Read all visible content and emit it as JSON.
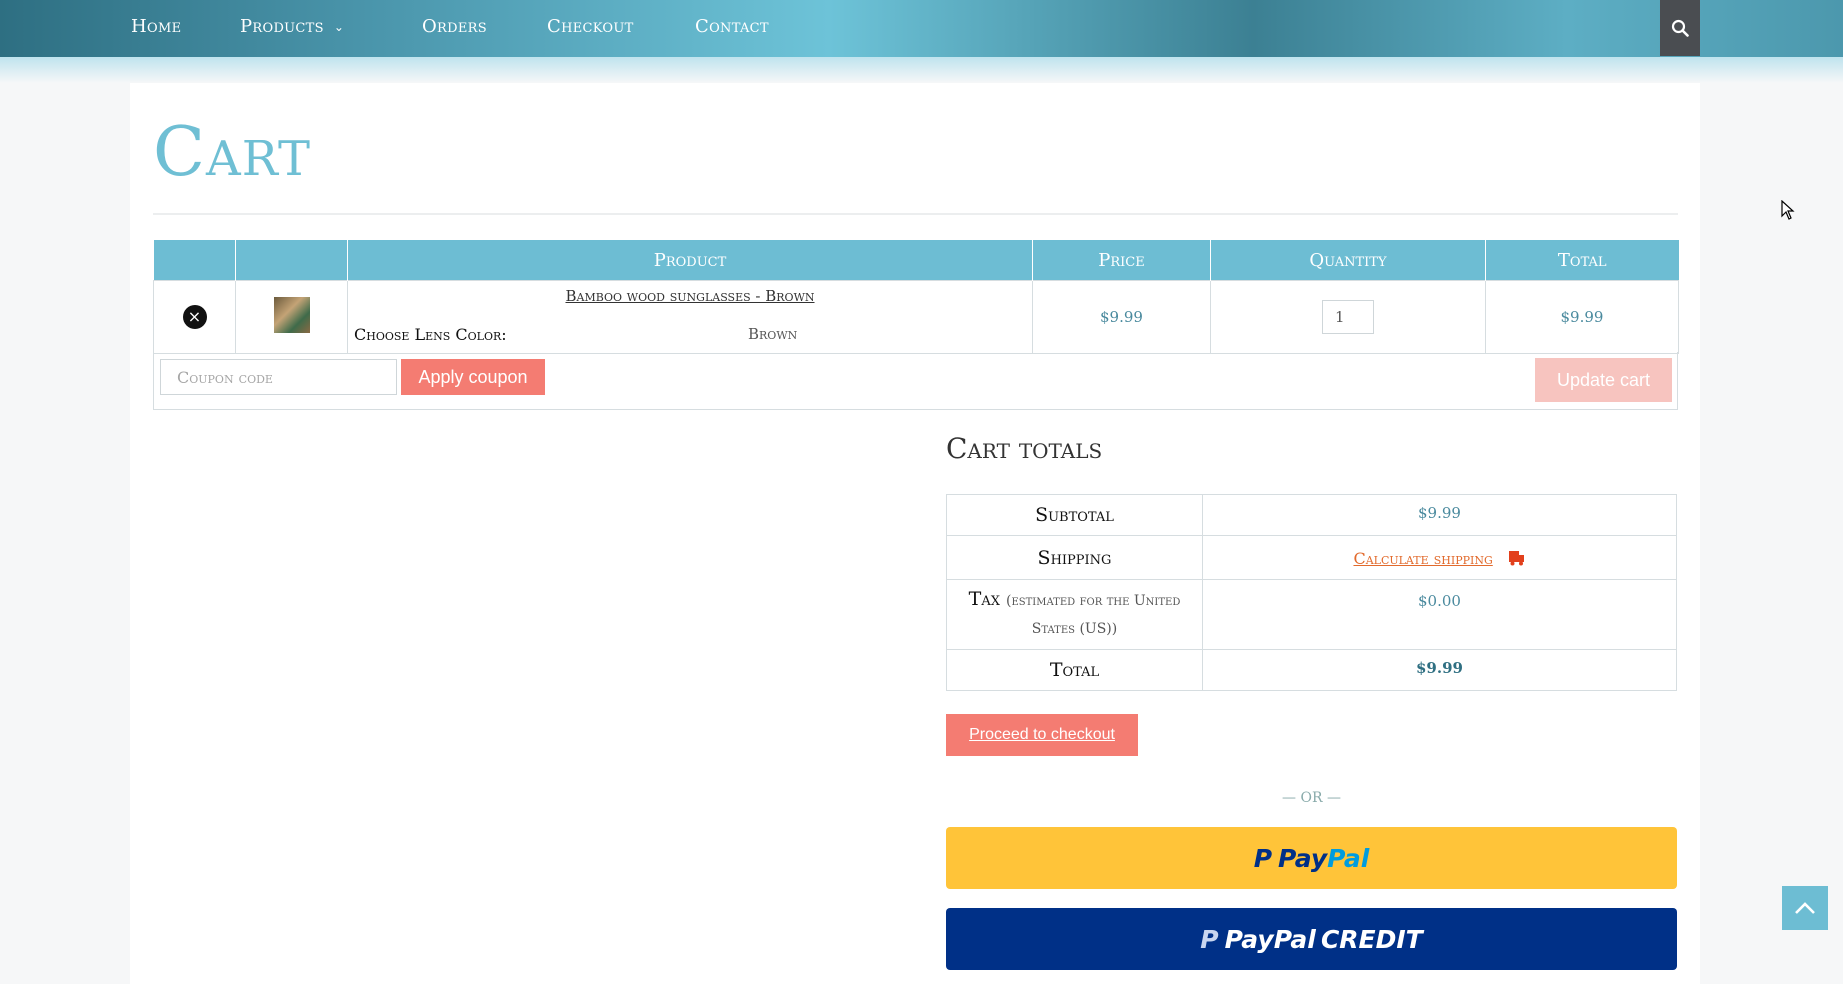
{
  "nav": {
    "items": [
      "Home",
      "Products",
      "Orders",
      "Checkout",
      "Contact"
    ],
    "search_icon": "search-icon",
    "dropdown_icon": "chevron-down-icon"
  },
  "page": {
    "title": "Cart"
  },
  "cart_table": {
    "headers": [
      "",
      "",
      "Product",
      "Price",
      "Quantity",
      "Total"
    ],
    "rows": [
      {
        "product_name": "Bamboo wood sunglasses - Brown",
        "option_label": "Choose Lens Color:",
        "option_value": "Brown",
        "price": "$9.99",
        "quantity": "1",
        "total": "$9.99"
      }
    ]
  },
  "coupon": {
    "placeholder": "Coupon code",
    "apply_label": "Apply coupon"
  },
  "update_cart_label": "Update cart",
  "totals": {
    "title": "Cart totals",
    "subtotal_label": "Subtotal",
    "subtotal_value": "$9.99",
    "shipping_label": "Shipping",
    "shipping_link": "Calculate shipping",
    "tax_label": "Tax",
    "tax_note": "(estimated for the United States (US))",
    "tax_value": "$0.00",
    "total_label": "Total",
    "total_value": "$9.99"
  },
  "checkout": {
    "proceed_label": "Proceed to checkout",
    "or_label": "— OR —",
    "paypal_pay": "Pay",
    "paypal_pal": "Pal",
    "paypal_credit_pay": "Pay",
    "paypal_credit_pal": "Pal",
    "paypal_credit_word": "CREDIT"
  },
  "colors": {
    "accent": "#6dbdd3",
    "button": "#f47c72",
    "paypal_yellow": "#ffc439",
    "paypal_navy": "#003087"
  }
}
